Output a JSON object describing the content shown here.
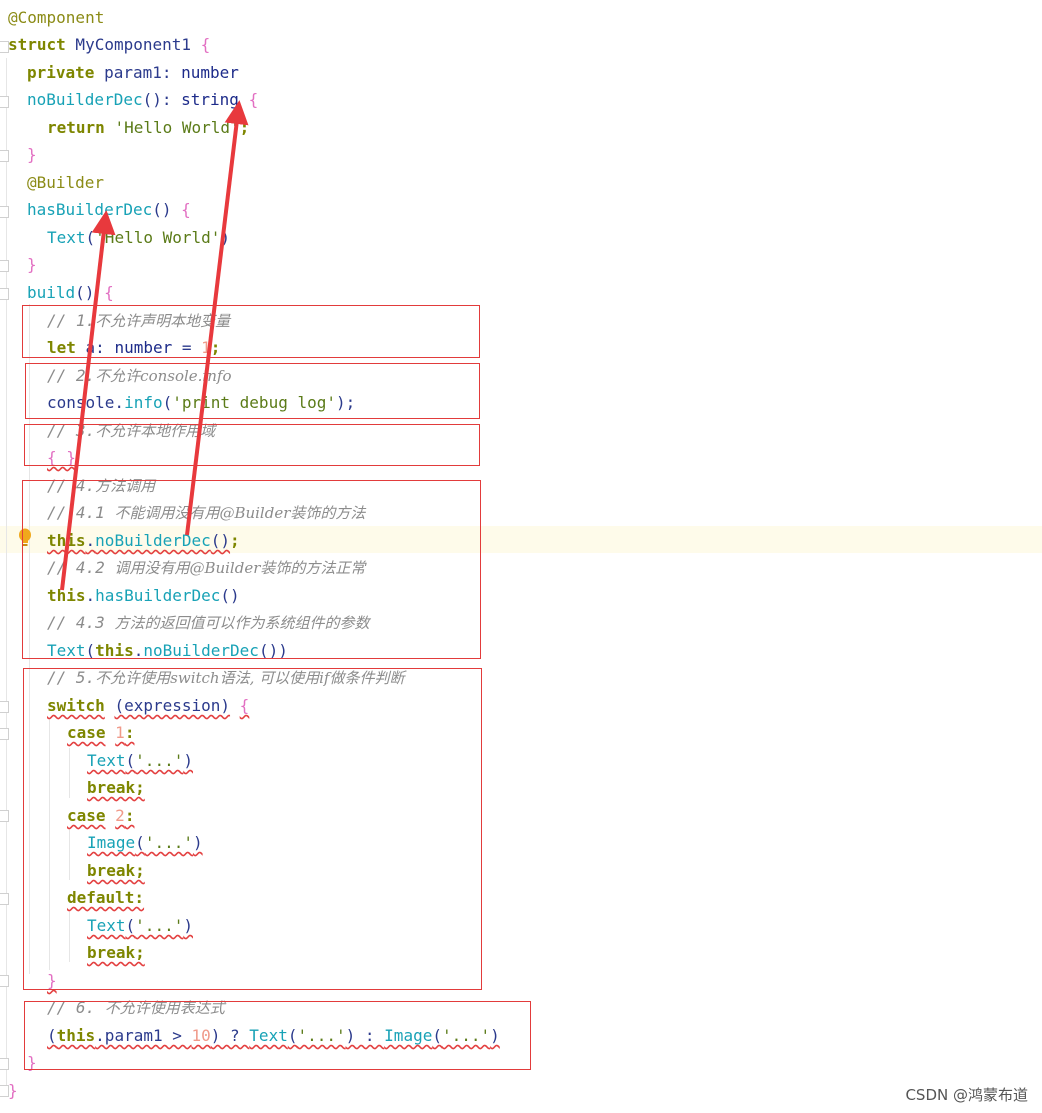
{
  "code_lines": [
    "@Component",
    "struct MyComponent1 {",
    "private param1: number",
    "noBuilderDec(): string {",
    "return 'Hello World';",
    "}",
    "@Builder",
    "hasBuilderDec() {",
    "Text('Hello World')",
    "}",
    "build() {",
    "// 1.不允许声明本地变量",
    "let a: number = 1;",
    "// 2.不允许console.info",
    "console.info('print debug log');",
    "// 3.不允许本地作用域",
    "{ }",
    "// 4.方法调用",
    "// 4.1 不能调用没有用@Builder装饰的方法",
    "this.noBuilderDec();",
    "// 4.2 调用没有用@Builder装饰的方法正常",
    "this.hasBuilderDec()",
    "// 4.3 方法的返回值可以作为系统组件的参数",
    "Text(this.noBuilderDec())",
    "// 5.不允许使用switch语法, 可以使用if做条件判断",
    "switch (expression) {",
    "case 1:",
    "Text('...')",
    "break;",
    "case 2:",
    "Image('...')",
    "break;",
    "default:",
    "Text('...')",
    "break;",
    "}",
    "// 6. 不允许使用表达式",
    "(this.param1 > 10) ? Text('...') : Image('...')",
    "}",
    "}"
  ],
  "watermark": "CSDN @鸿蒙布道"
}
